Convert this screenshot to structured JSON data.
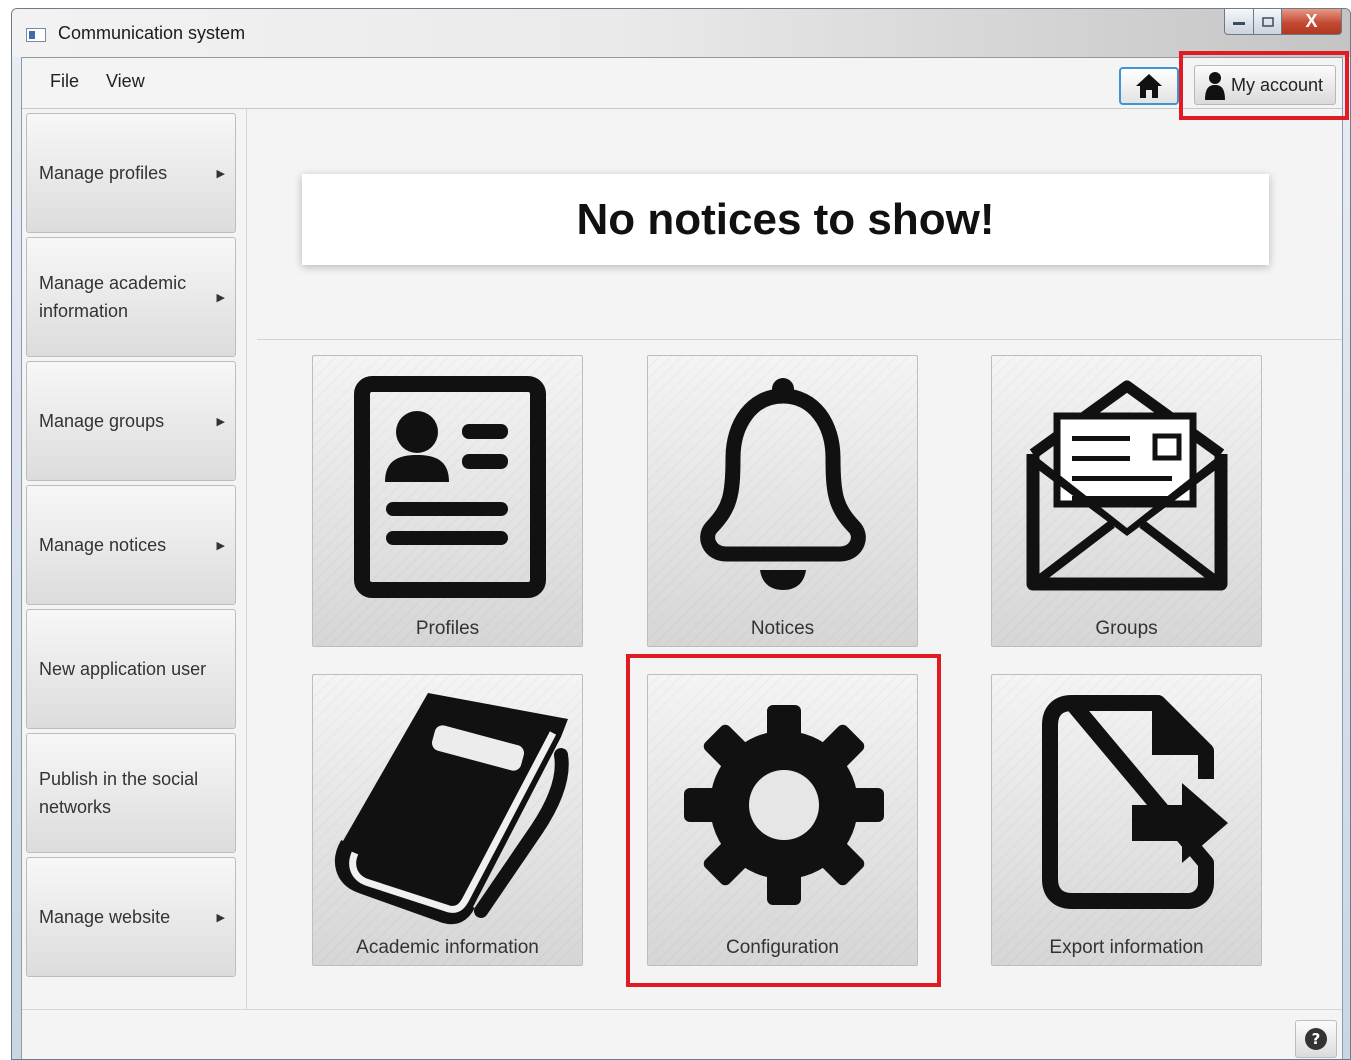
{
  "window": {
    "title": "Communication system"
  },
  "title_controls": {
    "close_glyph": "X"
  },
  "menubar": {
    "file": "File",
    "view": "View"
  },
  "toolbar": {
    "home_icon": "home-icon",
    "my_account": "My account"
  },
  "sidebar": {
    "items": [
      {
        "label": "Manage profiles",
        "arrow": "▶"
      },
      {
        "label": "Manage academic information",
        "arrow": "▶"
      },
      {
        "label": "Manage groups",
        "arrow": "▶"
      },
      {
        "label": "Manage notices",
        "arrow": "▶"
      },
      {
        "label": "New application user",
        "arrow": ""
      },
      {
        "label": "Publish in the social networks",
        "arrow": ""
      },
      {
        "label": "Manage website",
        "arrow": "▶"
      }
    ]
  },
  "main": {
    "notice_message": "No notices to show!",
    "tiles": [
      {
        "label": "Profiles",
        "icon": "profile-card-icon"
      },
      {
        "label": "Notices",
        "icon": "bell-icon"
      },
      {
        "label": "Groups",
        "icon": "envelope-icon"
      },
      {
        "label": "Academic information",
        "icon": "book-icon"
      },
      {
        "label": "Configuration",
        "icon": "gear-icon"
      },
      {
        "label": "Export information",
        "icon": "export-file-icon"
      }
    ]
  },
  "footer": {
    "help_icon": "help-icon"
  },
  "annotations": {
    "highlight_color": "#e01b24"
  }
}
